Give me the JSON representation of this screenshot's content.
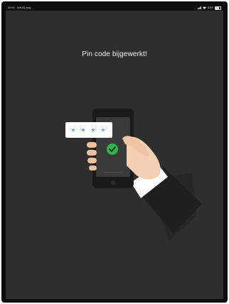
{
  "status_bar": {
    "time": "10:41",
    "date": "Ma 26 aug",
    "battery_percent": "69%",
    "battery_level": 0.69
  },
  "screen": {
    "title": "Pin code bijgewerkt!"
  },
  "illustration": {
    "pin_mask": [
      "*",
      "*",
      "*",
      "*"
    ],
    "success_icon": "checkmark-icon",
    "accent_color": "#31b54b",
    "pin_color": "#3a8ad8"
  }
}
